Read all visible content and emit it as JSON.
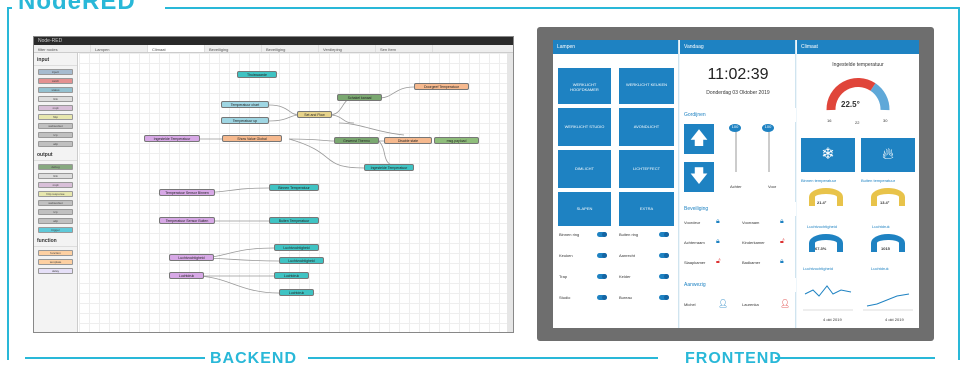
{
  "title": "NodeRED",
  "labels": {
    "backend": "BACKEND",
    "frontend": "FRONTEND"
  },
  "backend": {
    "window_title": "Node-RED",
    "filter_placeholder": "filter nodes",
    "tabs": [
      "Lampen",
      "Climaat",
      "Beveiliging",
      "Beveiliging",
      "Verdieping",
      "Sen Item"
    ],
    "categories": {
      "input": "input",
      "output": "output",
      "function": "function"
    },
    "input_nodes": [
      "inject",
      "catch",
      "status",
      "link",
      "mqtt",
      "http",
      "websocket",
      "tcp",
      "udp"
    ],
    "output_nodes": [
      "debug",
      "link",
      "mqtt",
      "http response",
      "websocket",
      "tcp",
      "udp",
      "trigger"
    ],
    "function_nodes": [
      "function",
      "template",
      "delay"
    ],
    "flow": {
      "thuis": "Thuiswaarde",
      "temp_chart": "Temperatuur chart",
      "temp_up": "Temperatuur up",
      "set_and_pro": "Set and Flow",
      "kop_temp": "Ingestelde Temperatuur",
      "show_value": "Show Value Global",
      "schakel": "Schakel kanaal",
      "thermo": "Gewenst Thermo",
      "doorgeef": "Doorgeef Temperatuur",
      "status": "Disable state",
      "msg": "msg.payload",
      "dummy": "Ingestelde Temperatuur",
      "bin_sensor": "Temperatuur Sensor Binnen",
      "bin_out": "Binnen Temperatuur",
      "buit_sensor": "Temperatuur Sensor Buiten",
      "buit_out": "Buiten Temperatuur",
      "lucht_s": "Luchtvochtigheid",
      "lucht_1": "Luchtvochtigheid",
      "lucht_2": "Luchtvochtigheid",
      "luchtdruk_s": "Luchtdruk",
      "luchtdruk_1": "Luchtdruk",
      "luchtdruk_2": "Luchtdruk"
    }
  },
  "frontend": {
    "lampen": {
      "title": "Lampen",
      "tiles": [
        "WERKLICHT HOOFDKAMER",
        "WERKLICHT KEUKEN",
        "WERKLICHT STUDIO",
        "AVONDLICHT",
        "DIMLICHT",
        "LICHTEFFECT",
        "SLAPEN",
        "EXTRA"
      ],
      "rows": [
        [
          "Binnen ring",
          "Buiten ring"
        ],
        [
          "Keuken",
          "Aanrecht"
        ],
        [
          "Trap",
          "Kelder"
        ],
        [
          "Studio",
          "Bureau"
        ]
      ]
    },
    "vandaag": {
      "title": "Vandaag",
      "time": "11:02:39",
      "date": "Donderdag 03 Oktober 2019"
    },
    "gordijnen": {
      "title": "Gordijnen",
      "left_val": "100",
      "right_val": "100",
      "achter": "Achter",
      "voor": "Voor"
    },
    "beveiliging": {
      "title": "Beveiliging",
      "items": [
        [
          "Voordeur",
          "Voorraam"
        ],
        [
          "Achterraam",
          "Kinderkamer"
        ],
        [
          "Slaapkamer",
          "Badkamer"
        ]
      ]
    },
    "aanwezig": {
      "title": "Aanwezig",
      "people": [
        "Michel",
        "Laurenka"
      ]
    },
    "climaat": {
      "title": "Climaat",
      "set_label": "Ingestelde temperatuur",
      "set_value": "22.5°",
      "min": "16",
      "mid": "22",
      "max": "30",
      "binnen_label": "Binnen temperatuur",
      "binnen_value": "21.4°",
      "buiten_label": "Buiten temperatuur",
      "buiten_value": "13.4°",
      "lucht_label": "Luchtvochtigheid",
      "lucht_value": "67.3%",
      "druk_label": "Luchtdruk",
      "druk_value": "1015",
      "chart1_label": "Luchtvochtigheid",
      "chart2_label": "Luchtdruk",
      "chart_date": "4 okt 2019"
    },
    "colors": {
      "tile": "#1e82c2",
      "gauge_red": "#e0453a",
      "gauge_blue": "#5fa8d8",
      "gauge_yellow": "#e8c34a",
      "accent": "#29b8d8"
    }
  }
}
